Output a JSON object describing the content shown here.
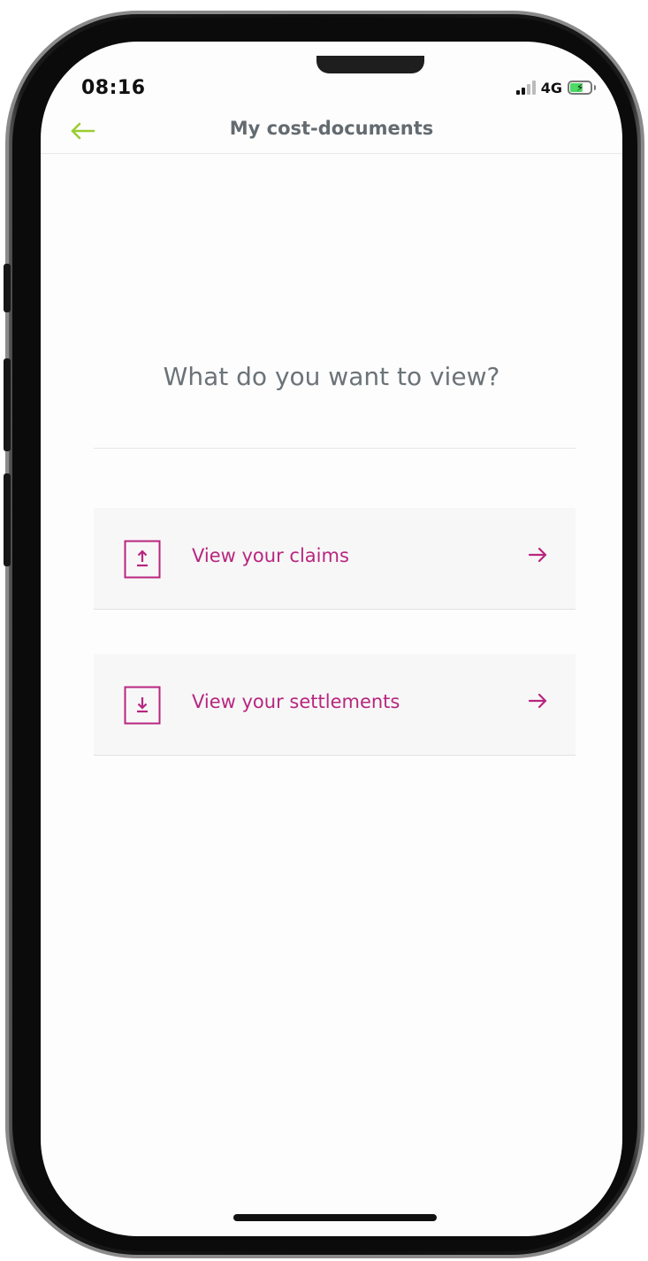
{
  "status_bar": {
    "time": "08:16",
    "network": "4G"
  },
  "nav": {
    "title": "My cost-documents",
    "back_icon": "arrow-left-icon"
  },
  "main": {
    "question": "What do you want to view?",
    "options": [
      {
        "label": "View your claims",
        "icon": "upload-document-icon",
        "arrow_icon": "arrow-right-icon"
      },
      {
        "label": "View your settlements",
        "icon": "download-document-icon",
        "arrow_icon": "arrow-right-icon"
      }
    ]
  },
  "colors": {
    "accent": "#b8267f",
    "back_arrow": "#9acd32",
    "title": "#636b70",
    "option_bg": "#f7f7f7",
    "battery": "#4cd964"
  }
}
